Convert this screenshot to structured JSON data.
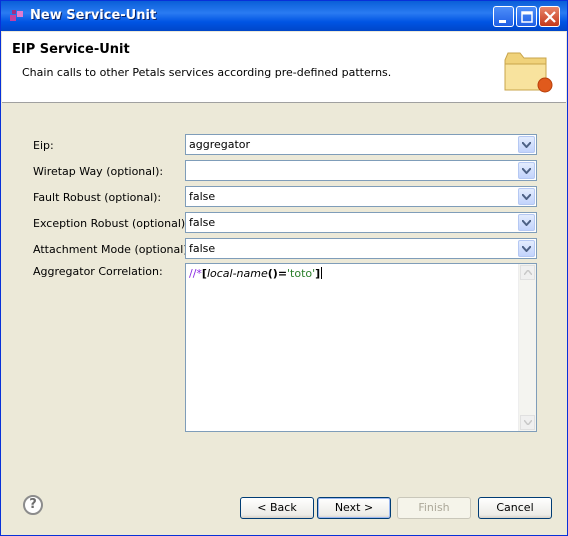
{
  "window": {
    "title": "New Service-Unit"
  },
  "header": {
    "title": "EIP Service-Unit",
    "description": "Chain calls to other Petals services according pre-defined patterns."
  },
  "form": {
    "eip": {
      "label": "Eip:",
      "value": "aggregator"
    },
    "wiretap": {
      "label": "Wiretap Way (optional):",
      "value": ""
    },
    "fault_robust": {
      "label": "Fault Robust (optional):",
      "value": "false"
    },
    "exception_robust": {
      "label": "Exception Robust (optional):",
      "value": "false"
    },
    "attachment_mode": {
      "label": "Attachment Mode (optional):",
      "value": "false"
    },
    "aggregator_correlation": {
      "label": "Aggregator Correlation:",
      "tokens": {
        "slashes": "//",
        "star": "*",
        "open_bracket": "[",
        "fn": "local-name",
        "parens": "()",
        "eq": "=",
        "str": "'toto'",
        "close_bracket": "]"
      }
    }
  },
  "buttons": {
    "help": "?",
    "back": "< Back",
    "next": "Next >",
    "finish": "Finish",
    "cancel": "Cancel"
  },
  "colors": {
    "titlebar": "#0054e3",
    "dialog_bg": "#ece9d8",
    "field_border": "#7f9db9"
  },
  "icons": [
    "app-icon",
    "minimize-icon",
    "maximize-icon",
    "close-icon",
    "folder-icon",
    "chevron-down-icon",
    "help-icon"
  ]
}
